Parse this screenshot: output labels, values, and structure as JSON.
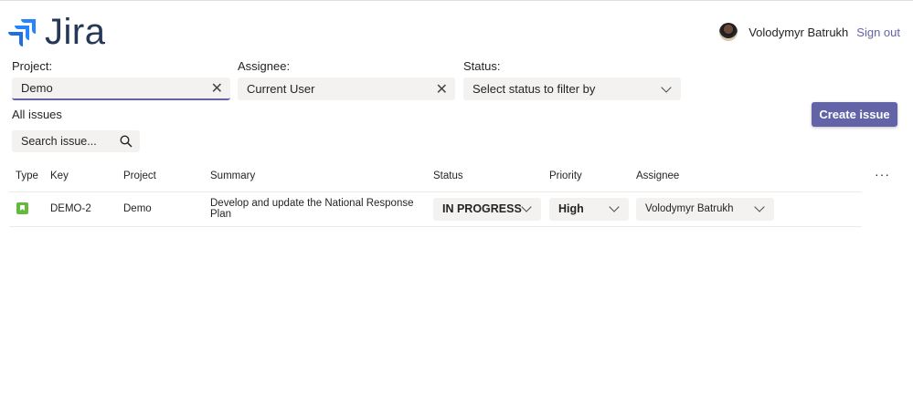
{
  "header": {
    "logo_text": "Jira",
    "user_name": "Volodymyr Batrukh",
    "sign_out": "Sign out"
  },
  "filters": {
    "project": {
      "label": "Project:",
      "value": "Demo"
    },
    "assignee": {
      "label": "Assignee:",
      "value": "Current User"
    },
    "status": {
      "label": "Status:",
      "placeholder": "Select status to filter by"
    }
  },
  "main": {
    "title": "All issues",
    "create_label": "Create issue",
    "search_placeholder": "Search issue..."
  },
  "table": {
    "columns": [
      "Type",
      "Key",
      "Project",
      "Summary",
      "Status",
      "Priority",
      "Assignee"
    ],
    "rows": [
      {
        "type": "story",
        "key": "DEMO-2",
        "project": "Demo",
        "summary": "Develop and update the National Response Plan",
        "status": "IN PROGRESS",
        "priority": "High",
        "assignee": "Volodymyr Batrukh"
      }
    ]
  },
  "colors": {
    "accent": "#6264a7",
    "story": "#63ba3c"
  }
}
